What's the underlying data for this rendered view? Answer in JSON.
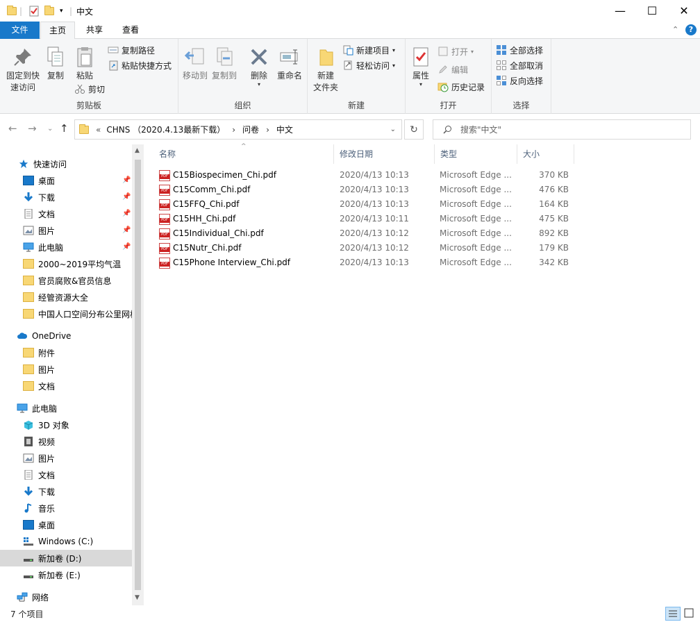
{
  "window": {
    "title": "中文",
    "minimize": "—",
    "maximize": "☐",
    "close": "✕"
  },
  "tabs": {
    "file": "文件",
    "home": "主页",
    "share": "共享",
    "view": "查看"
  },
  "ribbon": {
    "clipboard": {
      "label": "剪贴板",
      "pin": "固定到快\n速访问",
      "pin1": "固定到快",
      "pin2": "速访问",
      "copy": "复制",
      "paste": "粘贴",
      "copy_path": "复制路径",
      "paste_shortcut": "粘贴快捷方式",
      "cut": "剪切"
    },
    "organize": {
      "label": "组织",
      "move_to": "移动到",
      "copy_to": "复制到",
      "delete": "删除",
      "rename": "重命名"
    },
    "new": {
      "label": "新建",
      "new_folder1": "新建",
      "new_folder2": "文件夹",
      "new_item": "新建项目",
      "easy_access": "轻松访问"
    },
    "open": {
      "label": "打开",
      "properties": "属性",
      "open": "打开",
      "edit": "编辑",
      "history": "历史记录"
    },
    "select": {
      "label": "选择",
      "select_all": "全部选择",
      "select_none": "全部取消",
      "invert": "反向选择"
    }
  },
  "address": {
    "prefix": "«",
    "crumbs": [
      "CHNS （2020.4.13最新下载）",
      "问卷",
      "中文"
    ],
    "sep": "›",
    "search_placeholder": "搜索\"中文\""
  },
  "nav": {
    "quick_access": "快速访问",
    "quick": [
      "桌面",
      "下载",
      "文档",
      "图片",
      "此电脑",
      "2000~2019平均气温",
      "官员腐败&官员信息",
      "经管资源大全",
      "中国人口空间分布公里网格"
    ],
    "onedrive": "OneDrive",
    "onedrive_items": [
      "附件",
      "图片",
      "文档"
    ],
    "this_pc": "此电脑",
    "pc_items": [
      "3D 对象",
      "视频",
      "图片",
      "文档",
      "下载",
      "音乐",
      "桌面",
      "Windows (C:)",
      "新加卷 (D:)",
      "新加卷 (E:)"
    ],
    "network": "网络"
  },
  "columns": {
    "name": "名称",
    "date": "修改日期",
    "type": "类型",
    "size": "大小"
  },
  "files": [
    {
      "name": "C15Biospecimen_Chi.pdf",
      "date": "2020/4/13 10:13",
      "type": "Microsoft Edge ...",
      "size": "370 KB"
    },
    {
      "name": "C15Comm_Chi.pdf",
      "date": "2020/4/13 10:13",
      "type": "Microsoft Edge ...",
      "size": "476 KB"
    },
    {
      "name": "C15FFQ_Chi.pdf",
      "date": "2020/4/13 10:13",
      "type": "Microsoft Edge ...",
      "size": "164 KB"
    },
    {
      "name": "C15HH_Chi.pdf",
      "date": "2020/4/13 10:11",
      "type": "Microsoft Edge ...",
      "size": "475 KB"
    },
    {
      "name": "C15Individual_Chi.pdf",
      "date": "2020/4/13 10:12",
      "type": "Microsoft Edge ...",
      "size": "892 KB"
    },
    {
      "name": "C15Nutr_Chi.pdf",
      "date": "2020/4/13 10:12",
      "type": "Microsoft Edge ...",
      "size": "179 KB"
    },
    {
      "name": "C15Phone Interview_Chi.pdf",
      "date": "2020/4/13 10:13",
      "type": "Microsoft Edge ...",
      "size": "342 KB"
    }
  ],
  "status": {
    "count": "7 个项目"
  },
  "colors": {
    "accent": "#1979ca",
    "selection": "#d9d9d9",
    "folder": "#f8d775"
  }
}
